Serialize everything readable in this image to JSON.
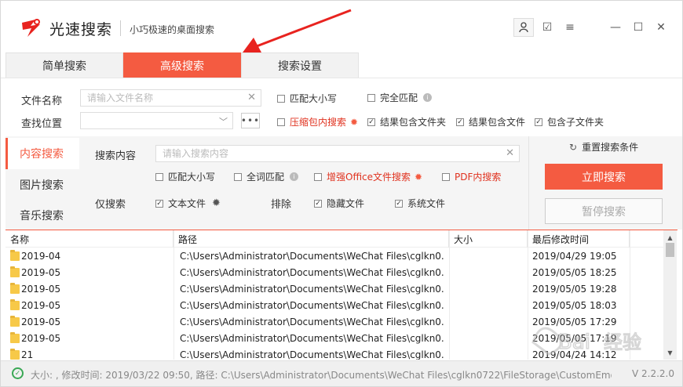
{
  "app": {
    "name": "光速搜索",
    "subtitle": "小巧极速的桌面搜索"
  },
  "window_buttons": [
    "user-icon",
    "edit-icon",
    "menu-icon",
    "minimize-icon",
    "maximize-icon",
    "close-icon"
  ],
  "window_glyphs": {
    "edit": "☑",
    "menu": "≡",
    "minimize": "—",
    "maximize": "☐",
    "close": "✕"
  },
  "tabs": [
    {
      "label": "简单搜索",
      "active": false
    },
    {
      "label": "高级搜索",
      "active": true
    },
    {
      "label": "搜索设置",
      "active": false
    }
  ],
  "filters": {
    "filename_label": "文件名称",
    "filename_placeholder": "请输入文件名称",
    "filename_value": "",
    "location_label": "查找位置",
    "location_value": "",
    "more_button": "•••",
    "clear_glyph": "✕",
    "dropdown_glyph": "﹀",
    "match_case": {
      "label": "匹配大小写",
      "checked": false
    },
    "exact_match": {
      "label": "完全匹配",
      "checked": false
    },
    "compressed": {
      "label": "压缩包内搜索",
      "checked": false
    },
    "include_folders": {
      "label": "结果包含文件夹",
      "checked": true
    },
    "include_files": {
      "label": "结果包含文件",
      "checked": true
    },
    "include_subfolders": {
      "label": "包含子文件夹",
      "checked": true
    }
  },
  "side_tabs": [
    {
      "label": "内容搜索",
      "active": true
    },
    {
      "label": "图片搜索",
      "active": false
    },
    {
      "label": "音乐搜索",
      "active": false
    }
  ],
  "content_search": {
    "label": "搜索内容",
    "placeholder": "请输入搜索内容",
    "value": "",
    "match_case": {
      "label": "匹配大小写",
      "checked": false
    },
    "whole_word": {
      "label": "全词匹配",
      "checked": false
    },
    "office": {
      "label": "增强Office文件搜索",
      "checked": false
    },
    "pdf": {
      "label": "PDF内搜索",
      "checked": false
    },
    "only_label": "仅搜索",
    "text_files": {
      "label": "文本文件",
      "checked": true
    },
    "exclude_label": "排除",
    "hidden_files": {
      "label": "隐藏文件",
      "checked": true
    },
    "system_files": {
      "label": "系统文件",
      "checked": true
    }
  },
  "actions": {
    "reset": "重置搜索条件",
    "search": "立即搜索",
    "pause": "暂停搜索"
  },
  "table": {
    "columns": [
      "名称",
      "路径",
      "大小",
      "最后修改时间"
    ],
    "rows": [
      {
        "name": "2019-04",
        "path": "C:\\Users\\Administrator\\Documents\\WeChat Files\\cglkn0...",
        "size": "",
        "modified": "2019/04/29 19:05"
      },
      {
        "name": "2019-05",
        "path": "C:\\Users\\Administrator\\Documents\\WeChat Files\\cglkn0...",
        "size": "",
        "modified": "2019/05/05 18:25"
      },
      {
        "name": "2019-05",
        "path": "C:\\Users\\Administrator\\Documents\\WeChat Files\\cglkn0...",
        "size": "",
        "modified": "2019/05/05 19:28"
      },
      {
        "name": "2019-05",
        "path": "C:\\Users\\Administrator\\Documents\\WeChat Files\\cglkn0...",
        "size": "",
        "modified": "2019/05/05 18:03"
      },
      {
        "name": "2019-05",
        "path": "C:\\Users\\Administrator\\Documents\\WeChat Files\\cglkn0...",
        "size": "",
        "modified": "2019/05/05 17:29"
      },
      {
        "name": "2019-05",
        "path": "C:\\Users\\Administrator\\Documents\\WeChat Files\\cglkn0...",
        "size": "",
        "modified": "2019/05/05 17:19"
      },
      {
        "name": "21",
        "path": "C:\\Users\\Administrator\\Documents\\WeChat Files\\cglkn0...",
        "size": "",
        "modified": "2019/04/24 14:12"
      }
    ]
  },
  "status": {
    "text": "大小: , 修改时间: 2019/03/22 09:50, 路径: C:\\Users\\Administrator\\Documents\\WeChat Files\\cglkn0722\\FileStorage\\CustomEmotion",
    "version": "V 2.2.2.0"
  },
  "watermark_text": "Baidu经验",
  "colors": {
    "accent": "#f45b41",
    "ok": "#3aa855",
    "arrow": "#e8231f"
  }
}
